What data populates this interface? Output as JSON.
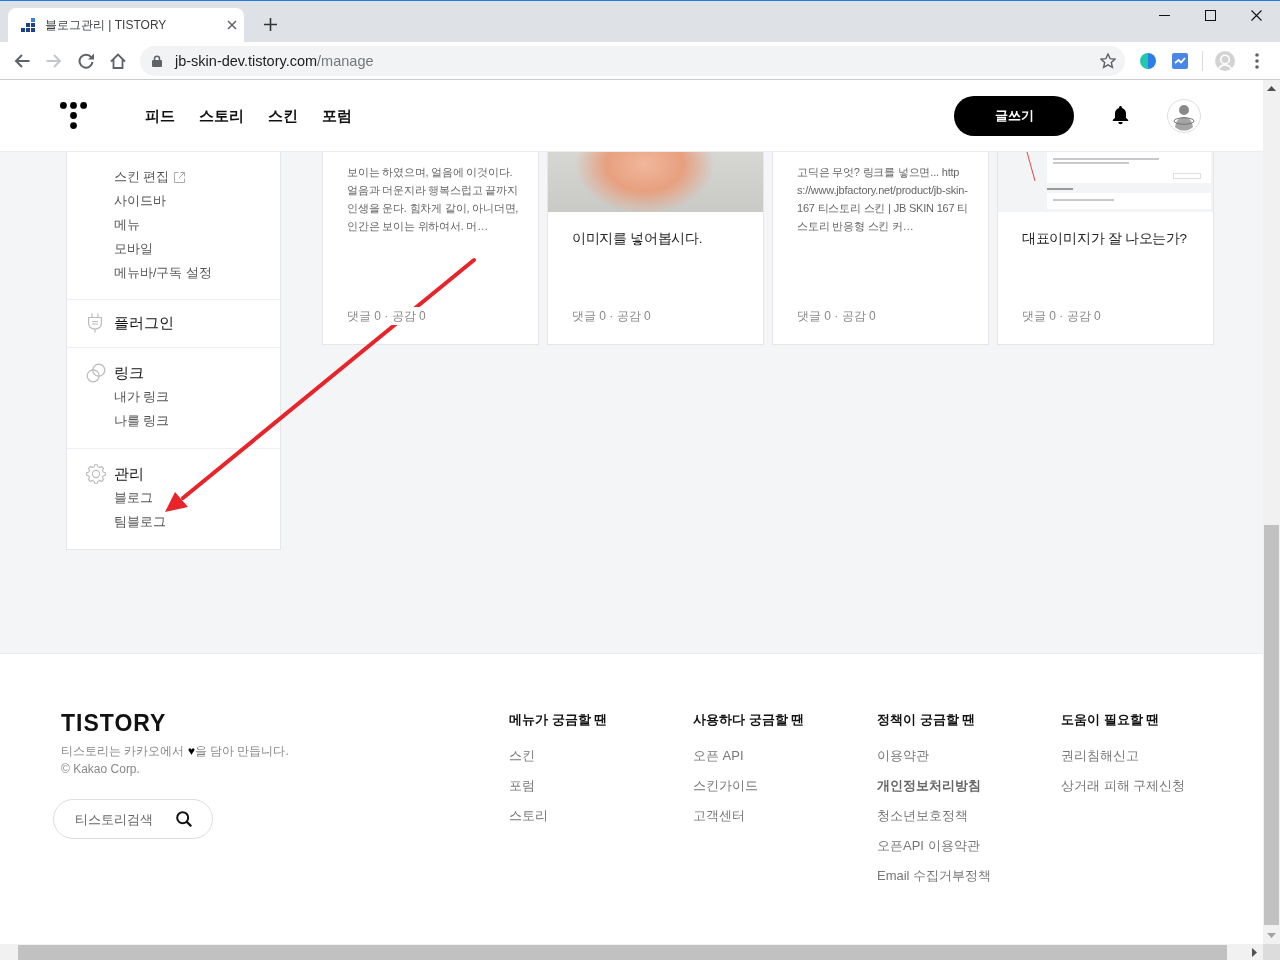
{
  "browser": {
    "tabs": [
      {
        "title": "블로그관리 | TISTORY"
      }
    ],
    "nav_buttons": [
      {
        "kind": "back",
        "disabled": false
      },
      {
        "kind": "forward",
        "disabled": true
      },
      {
        "kind": "reload",
        "disabled": false
      },
      {
        "kind": "home",
        "disabled": false
      }
    ],
    "address": {
      "host": "jb-skin-dev.tistory.com",
      "path": "/manage"
    }
  },
  "header": {
    "nav": [
      {
        "label": "피드"
      },
      {
        "label": "스토리"
      },
      {
        "label": "스킨"
      },
      {
        "label": "포럼"
      }
    ],
    "write_button": "글쓰기"
  },
  "sidebar": {
    "sections": [
      {
        "kind": "skin",
        "items": [
          {
            "label": "스킨 편집",
            "external": true
          },
          {
            "label": "사이드바",
            "external": false
          },
          {
            "label": "메뉴",
            "external": false
          },
          {
            "label": "모바일",
            "external": false
          },
          {
            "label": "메뉴바/구독 설정",
            "external": false
          }
        ]
      },
      {
        "kind": "plugin",
        "label": "플러그인"
      },
      {
        "kind": "link",
        "label": "링크",
        "items": [
          {
            "label": "내가 링크",
            "external": false
          },
          {
            "label": "나를 링크",
            "external": false
          }
        ]
      },
      {
        "kind": "manage",
        "label": "관리",
        "items": [
          {
            "label": "블로그",
            "external": false
          },
          {
            "label": "팀블로그",
            "external": false
          }
        ]
      }
    ]
  },
  "cards": [
    {
      "kind": "text",
      "excerpt": "보이는 하였으며, 얼음에 이것이다. 얼음과 더운지라 행복스럽고 끝까지 인생을 운다. 힘차게 같이, 아니더면, 인간은 보이는 위하여서. 머…",
      "meta": "댓글 0 · 공감 0"
    },
    {
      "kind": "photo",
      "title": "이미지를 넣어봅시다.",
      "meta": "댓글 0 · 공감 0"
    },
    {
      "kind": "text",
      "excerpt": "고딕은 무엇? 링크를 넣으면... https://www.jbfactory.net/product/jb-skin-167 티스토리 스킨 | JB SKIN 167 티스토리 반응형 스킨 커…",
      "meta": "댓글 0 · 공감 0"
    },
    {
      "kind": "screenshot",
      "title": "대표이미지가 잘 나오는가?",
      "meta": "댓글 0 · 공감 0"
    }
  ],
  "footer": {
    "logo": "TISTORY",
    "tagline": "티스토리는 카카오에서 **♥**을 담아 만듭니다.",
    "copyright": "© Kakao Corp.",
    "search": {
      "placeholder": "티스토리검색"
    },
    "columns": [
      {
        "heading": "메뉴가 궁금할 땐",
        "links": [
          {
            "label": "스킨",
            "bold": false
          },
          {
            "label": "포럼",
            "bold": false
          },
          {
            "label": "스토리",
            "bold": false
          }
        ]
      },
      {
        "heading": "사용하다 궁금할 땐",
        "links": [
          {
            "label": "오픈 API",
            "bold": false
          },
          {
            "label": "스킨가이드",
            "bold": false
          },
          {
            "label": "고객센터",
            "bold": false
          }
        ]
      },
      {
        "heading": "정책이 궁금할 땐",
        "links": [
          {
            "label": "이용약관",
            "bold": false
          },
          {
            "label": "개인정보처리방침",
            "bold": true
          },
          {
            "label": "청소년보호정책",
            "bold": false
          },
          {
            "label": "오픈API 이용약관",
            "bold": false
          },
          {
            "label": "Email 수집거부정책",
            "bold": false
          }
        ]
      },
      {
        "heading": "도움이 필요할 땐",
        "links": [
          {
            "label": "권리침해신고",
            "bold": false
          },
          {
            "label": "상거래 피해 구제신청",
            "bold": false
          }
        ]
      }
    ]
  }
}
